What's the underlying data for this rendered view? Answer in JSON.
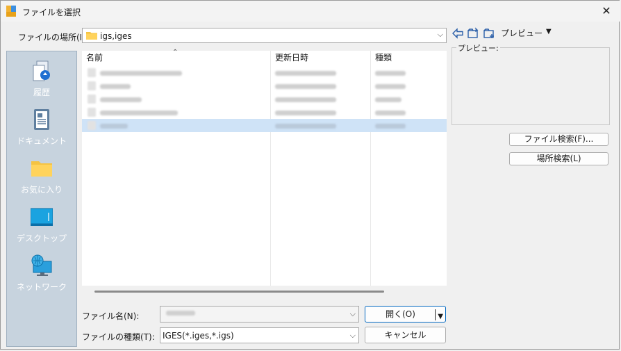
{
  "window": {
    "title": "ファイルを選択",
    "close_glyph": "✕"
  },
  "location": {
    "label": "ファイルの場所(I):",
    "value": "igs,iges"
  },
  "toolbar": {
    "preview_menu": "プレビュー",
    "preview_dropdown": "▼"
  },
  "preview": {
    "group_label": "プレビュー:"
  },
  "buttons": {
    "file_search": "ファイル検索(F)...",
    "location_search": "場所検索(L)",
    "open": "開く(O)",
    "cancel": "キャンセル"
  },
  "places": [
    {
      "label": "履歴",
      "icon": "history-icon"
    },
    {
      "label": "ドキュメント",
      "icon": "documents-icon"
    },
    {
      "label": "お気に入り",
      "icon": "favorites-folder-icon"
    },
    {
      "label": "デスクトップ",
      "icon": "desktop-icon"
    },
    {
      "label": "ネットワーク",
      "icon": "network-icon"
    }
  ],
  "file_list": {
    "columns": [
      "名前",
      "更新日時",
      "種類"
    ],
    "rows": [
      {
        "selected": false
      },
      {
        "selected": false
      },
      {
        "selected": false
      },
      {
        "selected": false
      },
      {
        "selected": true
      }
    ]
  },
  "filename": {
    "label": "ファイル名(N):",
    "value": ""
  },
  "filetype": {
    "label": "ファイルの種類(T):",
    "value": "IGES(*.iges,*.igs)"
  },
  "colors": {
    "selection": "#cfe3f7",
    "sidebar": "#c7d3de",
    "folder": "#f5c342"
  }
}
